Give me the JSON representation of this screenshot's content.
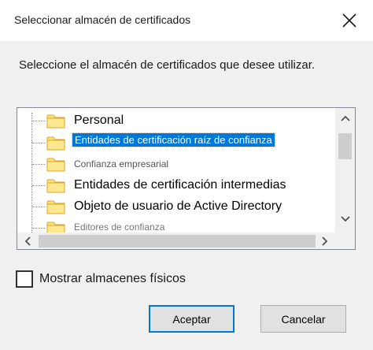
{
  "window": {
    "title": "Seleccionar almacén de certificados",
    "close_icon": "close-icon"
  },
  "instruction": "Seleccione el almacén de certificados que desee utilizar.",
  "tree": {
    "items": [
      {
        "label": "Personal",
        "icon": "folder-icon",
        "selected": false
      },
      {
        "label": "Entidades de certificación raíz de confianza",
        "icon": "folder-icon",
        "selected": true
      },
      {
        "label": "Confianza empresarial",
        "icon": "folder-icon",
        "selected": false
      },
      {
        "label": "Entidades de certificación intermedias",
        "icon": "folder-icon",
        "selected": false
      },
      {
        "label": "Objeto de usuario de Active Directory",
        "icon": "folder-icon",
        "selected": false
      },
      {
        "label": "Editores de confianza",
        "icon": "folder-icon",
        "selected": false
      }
    ],
    "selection_color": "#0078d7"
  },
  "checkbox": {
    "label": "Mostrar almacenes físicos",
    "checked": false
  },
  "buttons": {
    "ok": "Aceptar",
    "cancel": "Cancelar",
    "default_border_color": "#0078d7"
  }
}
